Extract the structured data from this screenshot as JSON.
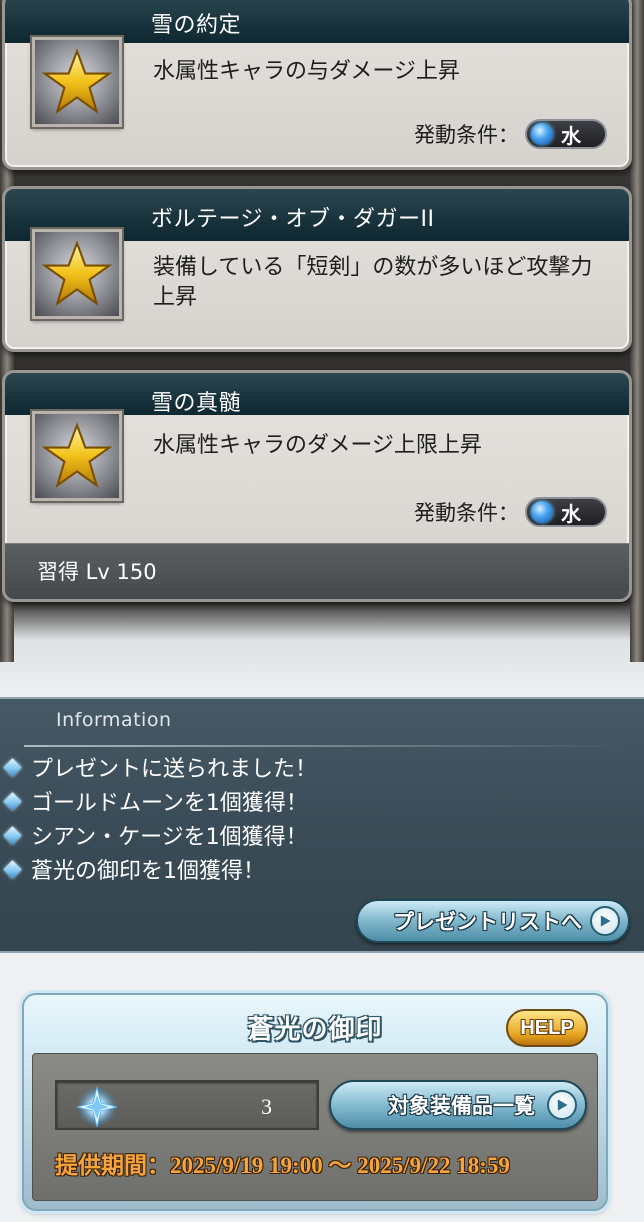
{
  "skills": [
    {
      "name": "雪の約定",
      "icon": "gold-star-icon",
      "description": "水属性キャラの与ダメージ上昇",
      "condition_label": "発動条件：",
      "condition_element": "水"
    },
    {
      "name": "ボルテージ・オブ・ダガーII",
      "icon": "gold-star-icon",
      "description": "装備している「短剣」の数が多いほど攻撃力上昇"
    },
    {
      "name": "雪の真髄",
      "icon": "gold-star-icon",
      "description": "水属性キャラのダメージ上限上昇",
      "condition_label": "発動条件：",
      "condition_element": "水",
      "learn_text": "習得 Lv 150"
    }
  ],
  "information": {
    "title": "Information",
    "items": [
      "プレゼントに送られました！",
      "ゴールドムーンを1個獲得！",
      "シアン・ケージを1個獲得！",
      "蒼光の御印を1個獲得！"
    ],
    "present_button_label": "プレゼントリストへ"
  },
  "seal": {
    "title": "蒼光の御印",
    "help_label": "HELP",
    "quantity": "3",
    "item_icon": "blue-crystal-icon",
    "equipment_button_label": "対象装備品一覧",
    "period_text": "提供期間：2025/9/19 19:00 〜 2025/9/22 18:59"
  },
  "colors": {
    "header_dark_teal": "#16303a",
    "info_panel": "#3a4c57",
    "button_blue": "#84bbd0",
    "help_gold": "#e6a421",
    "period_orange": "#f6a43e",
    "water_orb": "#4aa6f0"
  }
}
